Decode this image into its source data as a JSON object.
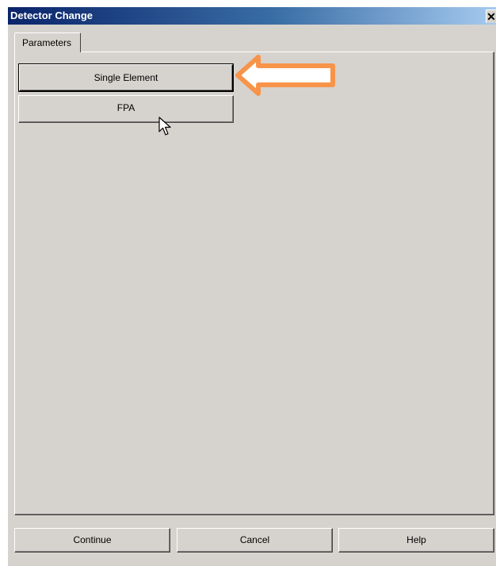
{
  "window": {
    "title": "Detector Change",
    "close_glyph": "✕"
  },
  "tabs": [
    {
      "label": "Parameters"
    }
  ],
  "parameters": {
    "single_element_label": "Single Element",
    "fpa_label": "FPA"
  },
  "footer": {
    "continue_label": "Continue",
    "cancel_label": "Cancel",
    "help_label": "Help"
  },
  "annotation": {
    "icon": "arrow-left-icon",
    "color": "#f7944a",
    "points_to": "Single Element"
  },
  "colors": {
    "dialog_bg": "#d6d3ce",
    "titlebar_start": "#0a246a",
    "titlebar_end": "#a6caf0"
  }
}
